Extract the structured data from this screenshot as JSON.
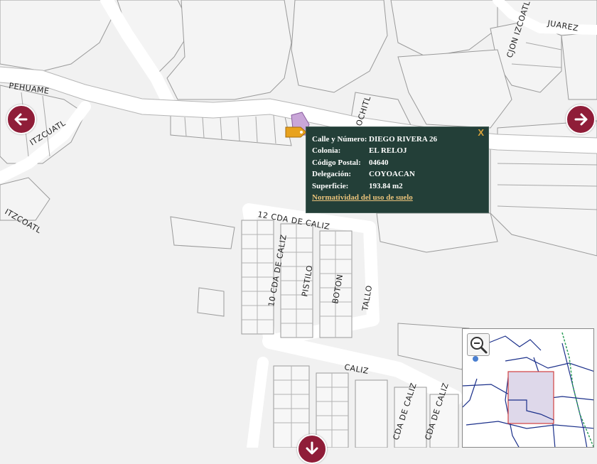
{
  "map": {
    "streets": {
      "pehuame": "PEHUAME",
      "itzcuatl": "ITZCUATL",
      "itzcoatl": "ITZCOATL",
      "cjon_izcoatl": "CJON IZCOATL",
      "juarez": "JUAREZ",
      "xochitl": "OCHITL",
      "cda12": "12 CDA DE CALIZ",
      "cda10": "10 CDA DE CALIZ",
      "pistilo": "PISTILO",
      "boton": "BOTON",
      "tallo": "TALLO",
      "caliz": "CALIZ",
      "cda_a": "CDA DE CALIZ",
      "cda_b": "CDA DE CALIZ"
    },
    "colors": {
      "nav_accent": "#8f1d38",
      "popup_bg": "#233f38",
      "parcel_highlight": "#c9a6d8"
    }
  },
  "popup": {
    "close_label": "X",
    "rows": [
      {
        "label": "Calle y Número:",
        "value": "DIEGO RIVERA 26"
      },
      {
        "label": "Colonia:",
        "value": "EL RELOJ"
      },
      {
        "label": "Código Postal:",
        "value": "04640"
      },
      {
        "label": "Delegación:",
        "value": "COYOACAN"
      },
      {
        "label": "Superficie:",
        "value": "193.84 m2"
      }
    ],
    "link": "Normatividad del uso de suelo"
  },
  "controls": {
    "nav_left_icon": "arrow-left-icon",
    "nav_right_icon": "arrow-right-icon",
    "nav_down_icon": "arrow-down-icon",
    "zoom_out_icon": "zoom-out-icon"
  }
}
